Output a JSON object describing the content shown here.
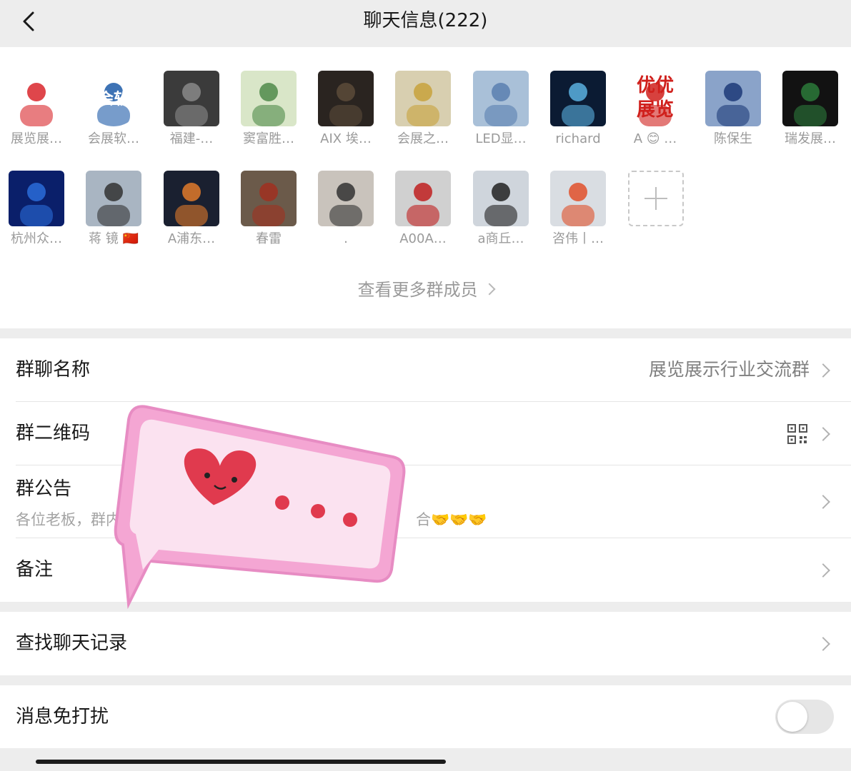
{
  "header": {
    "title": "聊天信息(222)",
    "back_icon": "chevron-left-icon"
  },
  "members": [
    {
      "name": "展览展…",
      "color": "#d9262c",
      "bg": "#ffffff"
    },
    {
      "name": "会展软…",
      "color": "#1c5aa8",
      "bg": "#ffffff",
      "badge": "会软"
    },
    {
      "name": "福建-…",
      "color": "#8a8a8a",
      "bg": "#3b3b3b"
    },
    {
      "name": "窦富胜…",
      "color": "#4f8a4a",
      "bg": "#d9e6c8"
    },
    {
      "name": "AIX 埃…",
      "color": "#5c4b3a",
      "bg": "#2a2420"
    },
    {
      "name": "会展之…",
      "color": "#c8a23c",
      "bg": "#d8cfb0"
    },
    {
      "name": "LED显…",
      "color": "#5a7fb0",
      "bg": "#a9c0d8"
    },
    {
      "name": "richard",
      "color": "#5ab0e0",
      "bg": "#0b1b33"
    },
    {
      "name": "A 😊 …",
      "color": "#d0201c",
      "bg": "#ffffff",
      "badge": "优优展览"
    },
    {
      "name": "陈保生",
      "color": "#1c3a78",
      "bg": "#8aa3c9"
    },
    {
      "name": "瑞发展…",
      "color": "#2c7a3a",
      "bg": "#121212"
    },
    {
      "name": "杭州众…",
      "color": "#2a6cd8",
      "bg": "#0a1f6a"
    },
    {
      "name": "蒋 镜 🇨🇳",
      "color": "#333333",
      "bg": "#a9b5c2"
    },
    {
      "name": "A浦东…",
      "color": "#e07a2a",
      "bg": "#1a2030"
    },
    {
      "name": "春雷",
      "color": "#a03020",
      "bg": "#6b5a4a"
    },
    {
      "name": ".",
      "color": "#333333",
      "bg": "#c9c3bc"
    },
    {
      "name": "A00A…",
      "color": "#c02020",
      "bg": "#d0d0d0"
    },
    {
      "name": "a商丘…",
      "color": "#222222",
      "bg": "#cfd5dc"
    },
    {
      "name": "咨伟丨…",
      "color": "#e0502a",
      "bg": "#d9dde2"
    }
  ],
  "more_members_label": "查看更多群成员",
  "settings": {
    "group_name": {
      "label": "群聊名称",
      "value": "展览展示行业交流群"
    },
    "qr_code": {
      "label": "群二维码",
      "icon": "qr-code-icon"
    },
    "announcement": {
      "label": "群公告",
      "preview": "各位老板，群内",
      "preview_end": "合🤝🤝🤝"
    },
    "remark": {
      "label": "备注"
    },
    "search_history": {
      "label": "查找聊天记录"
    },
    "mute": {
      "label": "消息免打扰",
      "enabled": false
    }
  },
  "colors": {
    "page_bg": "#ededed",
    "card_bg": "#ffffff",
    "sticker_pink": "#f4a6d3",
    "heart_red": "#e03a4e"
  }
}
